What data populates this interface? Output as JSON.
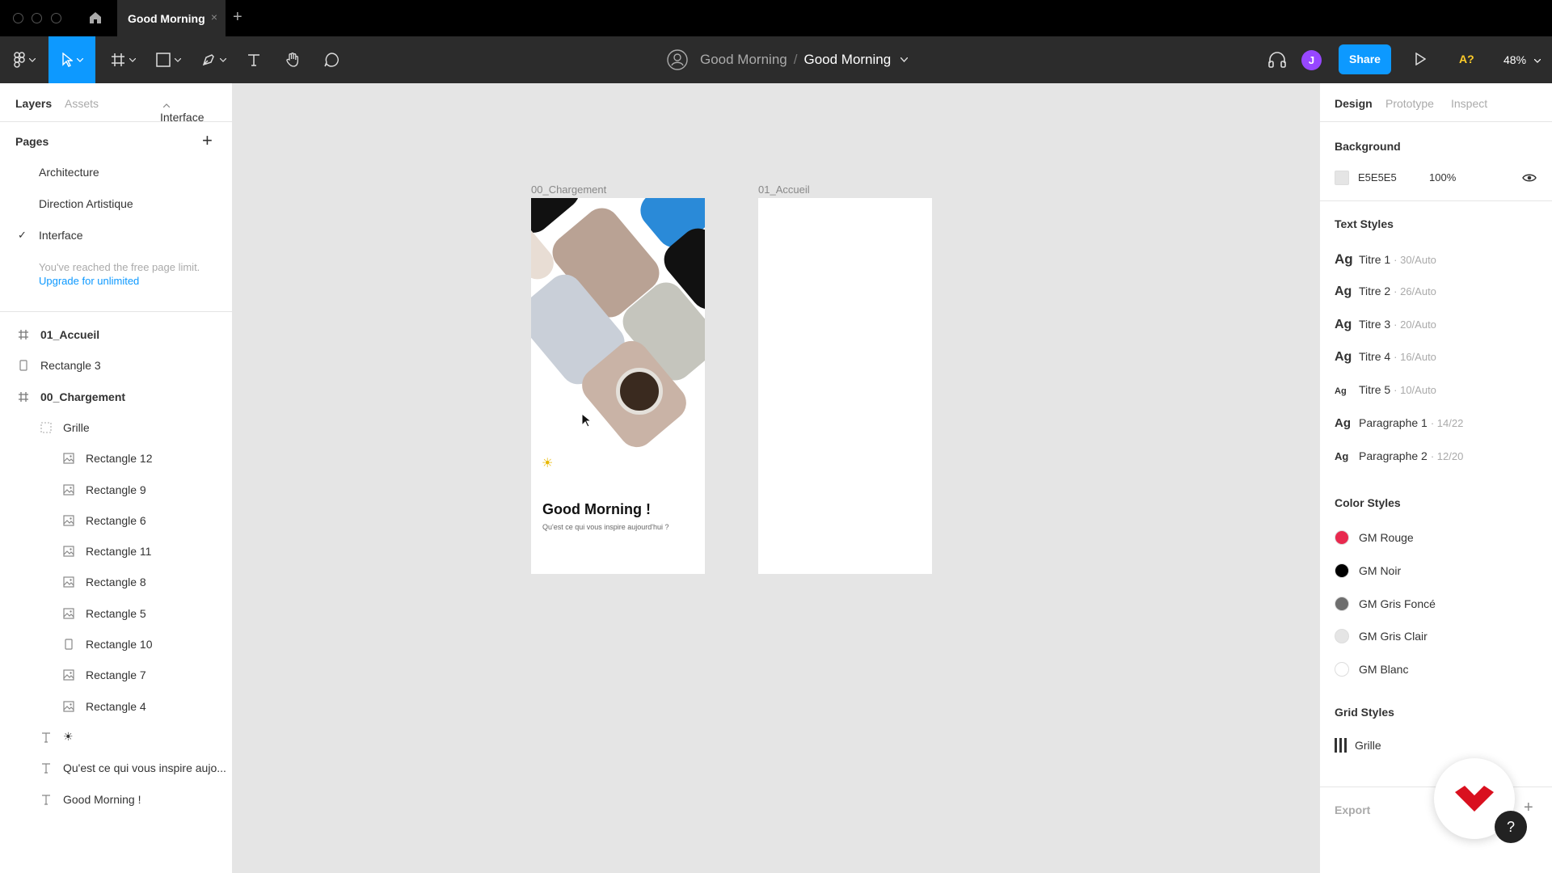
{
  "titlebar": {
    "tab_title": "Good Morning",
    "tab_close": "×",
    "new_tab": "+"
  },
  "toolbar": {
    "team": "Good Morning",
    "separator": "/",
    "file": "Good Morning",
    "avatar_initial": "J",
    "share_label": "Share",
    "a_label": "A?",
    "zoom": "48%"
  },
  "left_panel": {
    "tabs": {
      "layers": "Layers",
      "assets": "Assets",
      "page_select": "Interface"
    },
    "pages_title": "Pages",
    "pages_add": "+",
    "pages": [
      {
        "label": "Architecture",
        "selected": false
      },
      {
        "label": "Direction Artistique",
        "selected": false
      },
      {
        "label": "Interface",
        "selected": true
      }
    ],
    "check": "✓",
    "limit_text": "You've reached the free page limit.",
    "upgrade_link": "Upgrade for unlimited",
    "layers": [
      {
        "label": "01_Accueil",
        "icon": "frame-icon",
        "indent": 0,
        "bold": true
      },
      {
        "label": "Rectangle 3",
        "icon": "rectangle-icon",
        "indent": 0,
        "bold": false
      },
      {
        "label": "00_Chargement",
        "icon": "frame-icon",
        "indent": 0,
        "bold": true
      },
      {
        "label": "Grille",
        "icon": "grid-layer-icon",
        "indent": 1,
        "bold": false
      },
      {
        "label": "Rectangle 12",
        "icon": "image-icon",
        "indent": 2,
        "bold": false
      },
      {
        "label": "Rectangle 9",
        "icon": "image-icon",
        "indent": 2,
        "bold": false
      },
      {
        "label": "Rectangle 6",
        "icon": "image-icon",
        "indent": 2,
        "bold": false
      },
      {
        "label": "Rectangle 11",
        "icon": "image-icon",
        "indent": 2,
        "bold": false
      },
      {
        "label": "Rectangle 8",
        "icon": "image-icon",
        "indent": 2,
        "bold": false
      },
      {
        "label": "Rectangle 5",
        "icon": "image-icon",
        "indent": 2,
        "bold": false
      },
      {
        "label": "Rectangle 10",
        "icon": "rectangle-icon",
        "indent": 2,
        "bold": false
      },
      {
        "label": "Rectangle 7",
        "icon": "image-icon",
        "indent": 2,
        "bold": false
      },
      {
        "label": "Rectangle 4",
        "icon": "image-icon",
        "indent": 2,
        "bold": false
      },
      {
        "label": "☀",
        "icon": "text-icon",
        "indent": 1,
        "bold": false
      },
      {
        "label": "Qu'est ce qui vous inspire aujo...",
        "icon": "text-icon",
        "indent": 1,
        "bold": false
      },
      {
        "label": "Good Morning !",
        "icon": "text-icon",
        "indent": 1,
        "bold": false
      }
    ]
  },
  "canvas": {
    "frame1_label": "00_Chargement",
    "frame2_label": "01_Accueil",
    "sun": "☀",
    "headline": "Good Morning !",
    "subline": "Qu'est ce qui vous inspire aujourd'hui ?"
  },
  "right_panel": {
    "tabs": {
      "design": "Design",
      "prototype": "Prototype",
      "inspect": "Inspect"
    },
    "background_title": "Background",
    "background_hex": "E5E5E5",
    "background_opacity": "100%",
    "text_styles_title": "Text Styles",
    "text_styles": [
      {
        "ag": "Ag",
        "name": "Titre 1",
        "meta": "· 30/Auto",
        "size": 17
      },
      {
        "ag": "Ag",
        "name": "Titre 2",
        "meta": "· 26/Auto",
        "size": 16
      },
      {
        "ag": "Ag",
        "name": "Titre 3",
        "meta": "· 20/Auto",
        "size": 16
      },
      {
        "ag": "Ag",
        "name": "Titre 4",
        "meta": "· 16/Auto",
        "size": 16
      },
      {
        "ag": "Ag",
        "name": "Titre 5",
        "meta": "· 10/Auto",
        "size": 11
      },
      {
        "ag": "Ag",
        "name": "Paragraphe 1",
        "meta": "· 14/22",
        "size": 15
      },
      {
        "ag": "Ag",
        "name": "Paragraphe 2",
        "meta": "· 12/20",
        "size": 13
      }
    ],
    "color_styles_title": "Color Styles",
    "color_styles": [
      {
        "name": "GM Rouge",
        "color": "#e8294e"
      },
      {
        "name": "GM Noir",
        "color": "#000000"
      },
      {
        "name": "GM Gris Foncé",
        "color": "#6e6e6e"
      },
      {
        "name": "GM Gris Clair",
        "color": "#e5e5e5"
      },
      {
        "name": "GM Blanc",
        "color": "#ffffff"
      }
    ],
    "grid_styles_title": "Grid Styles",
    "grid_style": "Grille",
    "export_title": "Export",
    "export_add": "+",
    "help": "?"
  },
  "colors": {
    "accent": "#0d99ff",
    "toolbar_bg": "#2c2c2c",
    "titlebar_bg": "#000000",
    "canvas_bg": "#e5e5e5",
    "logo_red": "#d9101f"
  }
}
